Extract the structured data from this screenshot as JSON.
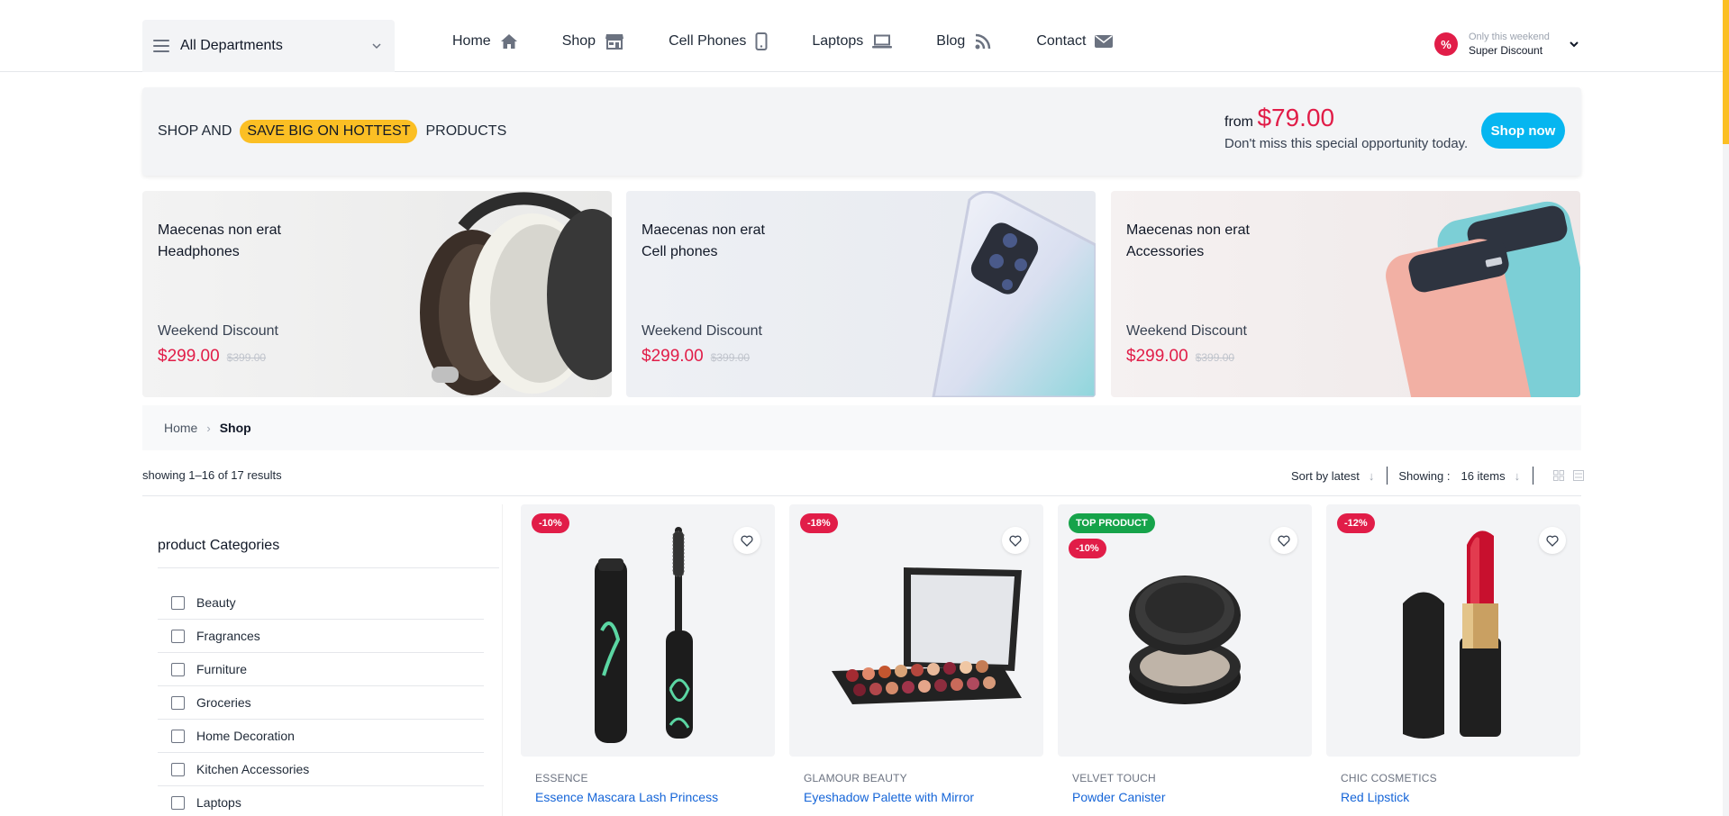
{
  "header": {
    "departments_label": "All Departments",
    "nav": [
      {
        "label": "Home",
        "icon": "home-icon"
      },
      {
        "label": "Shop",
        "icon": "store-icon"
      },
      {
        "label": "Cell Phones",
        "icon": "phone-icon"
      },
      {
        "label": "Laptops",
        "icon": "laptop-icon"
      },
      {
        "label": "Blog",
        "icon": "rss-icon"
      },
      {
        "label": "Contact",
        "icon": "envelope-icon"
      }
    ],
    "promo": {
      "badge": "%",
      "small": "Only this weekend",
      "big": "Super Discount"
    }
  },
  "banner": {
    "left_text": "SHOP AND",
    "highlight": "SAVE BIG ON HOTTEST",
    "right_text": "PRODUCTS",
    "from_label": "from",
    "price": "$79.00",
    "description": "Don't miss this special opportunity today.",
    "button": "Shop now"
  },
  "promo_cards": [
    {
      "title_line1": "Maecenas non erat",
      "title_line2": "Headphones",
      "discount_label": "Weekend Discount",
      "price": "$299.00",
      "old_price": "$399.00"
    },
    {
      "title_line1": "Maecenas non erat",
      "title_line2": "Cell phones",
      "discount_label": "Weekend Discount",
      "price": "$299.00",
      "old_price": "$399.00"
    },
    {
      "title_line1": "Maecenas non erat",
      "title_line2": "Accessories",
      "discount_label": "Weekend Discount",
      "price": "$299.00",
      "old_price": "$399.00"
    }
  ],
  "breadcrumb": {
    "home": "Home",
    "separator": "›",
    "current": "Shop"
  },
  "results": {
    "summary": "showing 1–16 of 17 results",
    "sort_label": "Sort by latest",
    "showing_label": "Showing :",
    "showing_value": "16 items"
  },
  "sidebar": {
    "title": "product Categories",
    "categories": [
      "Beauty",
      "Fragrances",
      "Furniture",
      "Groceries",
      "Home Decoration",
      "Kitchen Accessories",
      "Laptops"
    ]
  },
  "products": [
    {
      "tags": [
        "-10%"
      ],
      "brand": "ESSENCE",
      "name": "Essence Mascara Lash Princess"
    },
    {
      "tags": [
        "-18%"
      ],
      "brand": "GLAMOUR BEAUTY",
      "name": "Eyeshadow Palette with Mirror"
    },
    {
      "tags": [
        "TOP PRODUCT",
        "-10%"
      ],
      "brand": "VELVET TOUCH",
      "name": "Powder Canister"
    },
    {
      "tags": [
        "-12%"
      ],
      "brand": "CHIC COSMETICS",
      "name": "Red Lipstick"
    }
  ],
  "colors": {
    "accent_red": "#e11d48",
    "accent_yellow": "#fbbf24",
    "accent_cyan": "#06b6f0",
    "link_blue": "#1565d8",
    "tag_green": "#16a34a"
  }
}
